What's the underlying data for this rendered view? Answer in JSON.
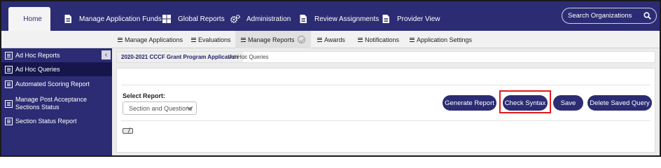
{
  "topnav": {
    "tabs": [
      {
        "label": "Home",
        "icon": "home-icon"
      },
      {
        "label": "Manage Application Funds",
        "icon": "document-icon"
      },
      {
        "label": "Global Reports",
        "icon": "grid-icon"
      },
      {
        "label": "Administration",
        "icon": "gears-icon"
      },
      {
        "label": "Review Assignments",
        "icon": "document-icon"
      },
      {
        "label": "Provider View",
        "icon": "document-icon"
      }
    ],
    "search_placeholder": "Search Organizations"
  },
  "subnav": {
    "items": [
      {
        "label": "Manage Applications"
      },
      {
        "label": "Evaluations"
      },
      {
        "label": "Manage Reports"
      },
      {
        "label": "Awards"
      },
      {
        "label": "Notifications"
      },
      {
        "label": "Application Settings"
      }
    ]
  },
  "sidebar": {
    "collapse_glyph": "‹",
    "items": [
      {
        "label": "Ad Hoc Reports"
      },
      {
        "label": "Ad Hoc Queries"
      },
      {
        "label": "Automated Scoring Report"
      },
      {
        "label": "Manage Post Acceptance Sections Status"
      },
      {
        "label": "Section Status Report"
      }
    ]
  },
  "breadcrumb": {
    "program": "2020-2021 CCCF Grant Program Application",
    "current": "Ad Hoc Queries"
  },
  "main": {
    "select_label": "Select Report:",
    "select_value": "Section and Questions",
    "buttons": {
      "generate": "Generate Report",
      "check_syntax": "Check Syntax",
      "save": "Save",
      "delete": "Delete Saved Query"
    }
  },
  "colors": {
    "brand_navy": "#2c2c74",
    "sidebar_active": "#16164d",
    "highlight_red": "#e21a1a"
  }
}
